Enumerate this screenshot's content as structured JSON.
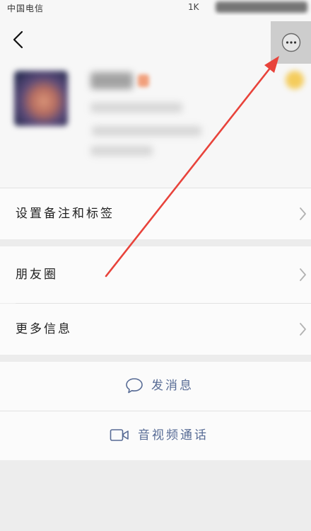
{
  "status_bar": {
    "carrier": "中国电信",
    "speed": "1K"
  },
  "header": {
    "back_icon": "chevron-left-icon",
    "more_icon": "more-dots-icon"
  },
  "profile": {
    "star_icon": "star-icon"
  },
  "menu": {
    "items": [
      {
        "label": "设置备注和标签",
        "icon": "chevron-right-icon"
      },
      {
        "label": "朋友圈",
        "icon": "chevron-right-icon"
      },
      {
        "label": "更多信息",
        "icon": "chevron-right-icon"
      }
    ]
  },
  "actions": {
    "message": {
      "label": "发消息",
      "icon": "chat-bubble-icon"
    },
    "call": {
      "label": "音视频通话",
      "icon": "video-call-icon"
    }
  },
  "colors": {
    "action_text": "#576b95",
    "annotation_arrow": "#e8433b",
    "highlight_box": "#cdcdcd",
    "page_background": "#ededed"
  }
}
